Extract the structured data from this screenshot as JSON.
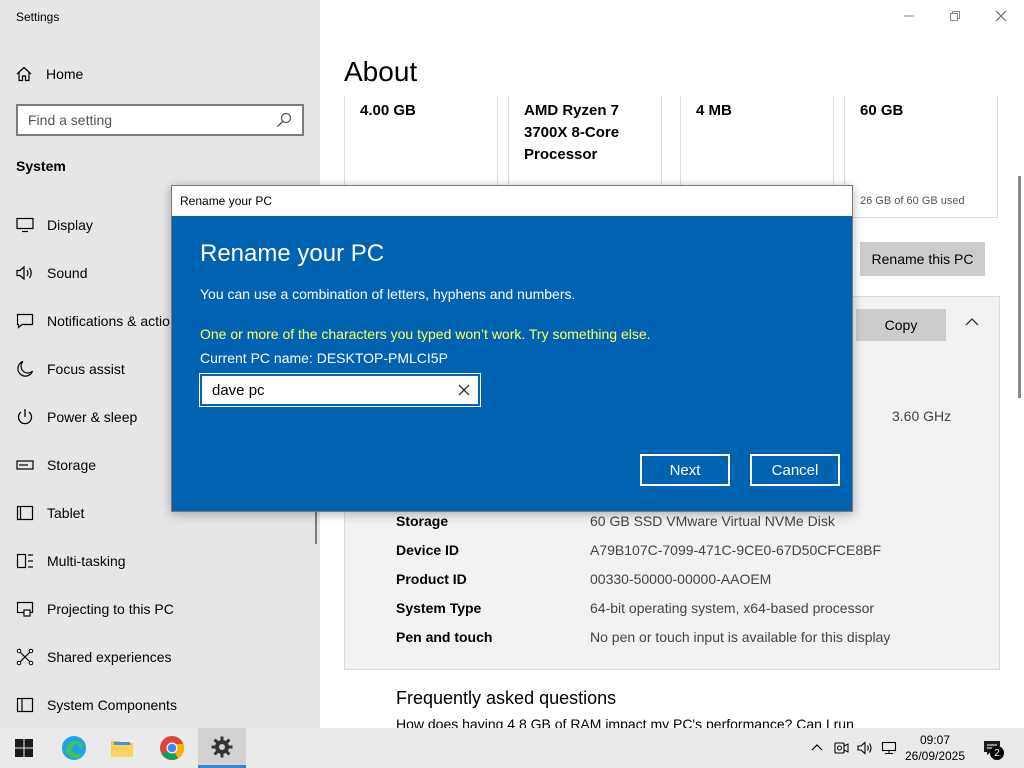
{
  "app": {
    "title": "Settings"
  },
  "sidebar": {
    "home_label": "Home",
    "search_placeholder": "Find a setting",
    "section_label": "System",
    "items": [
      {
        "label": "Display",
        "icon": "display-icon"
      },
      {
        "label": "Sound",
        "icon": "sound-icon"
      },
      {
        "label": "Notifications & actions",
        "icon": "notifications-icon"
      },
      {
        "label": "Focus assist",
        "icon": "focus-assist-icon"
      },
      {
        "label": "Power & sleep",
        "icon": "power-icon"
      },
      {
        "label": "Storage",
        "icon": "storage-icon"
      },
      {
        "label": "Tablet",
        "icon": "tablet-icon"
      },
      {
        "label": "Multi-tasking",
        "icon": "multitasking-icon"
      },
      {
        "label": "Projecting to this PC",
        "icon": "projecting-icon"
      },
      {
        "label": "Shared experiences",
        "icon": "shared-experiences-icon"
      },
      {
        "label": "System Components",
        "icon": "system-components-icon"
      }
    ]
  },
  "main": {
    "title": "About",
    "cards": [
      {
        "value": "4.00 GB",
        "sub": ""
      },
      {
        "value": "AMD Ryzen 7 3700X 8-Core Processor",
        "sub": ""
      },
      {
        "value": "4 MB",
        "sub": ""
      },
      {
        "value": "60 GB",
        "sub": "26 GB of 60 GB used"
      }
    ],
    "rename_button": "Rename this PC",
    "copy_button": "Copy",
    "processor_speed": "3.60 GHz",
    "specs": [
      {
        "key": "Storage",
        "value": "60 GB SSD VMware Virtual NVMe Disk"
      },
      {
        "key": "Device ID",
        "value": "A79B107C-7099-471C-9CE0-67D50CFCE8BF"
      },
      {
        "key": "Product ID",
        "value": "00330-50000-00000-AAOEM"
      },
      {
        "key": "System Type",
        "value": "64-bit operating system, x64-based processor"
      },
      {
        "key": "Pen and touch",
        "value": "No pen or touch input is available for this display"
      }
    ],
    "faq_title": "Frequently asked questions",
    "faq_link": "How does having 4 8 GB of RAM impact my PC's performance? Can I run"
  },
  "dialog": {
    "window_title": "Rename your PC",
    "heading": "Rename your PC",
    "description": "You can use a combination of letters, hyphens and numbers.",
    "error": "One or more of the characters you typed won’t work. Try something else.",
    "current_name": "Current PC name: DESKTOP-PMLCI5P",
    "input_value": "dave pc",
    "next_label": "Next",
    "cancel_label": "Cancel"
  },
  "taskbar": {
    "time": "09:07",
    "date": "26/09/2025",
    "notification_count": "2"
  },
  "colors": {
    "dialog_bg": "#0063b1",
    "error_text": "#ffff66",
    "sidebar_bg": "#e6e6e6"
  }
}
